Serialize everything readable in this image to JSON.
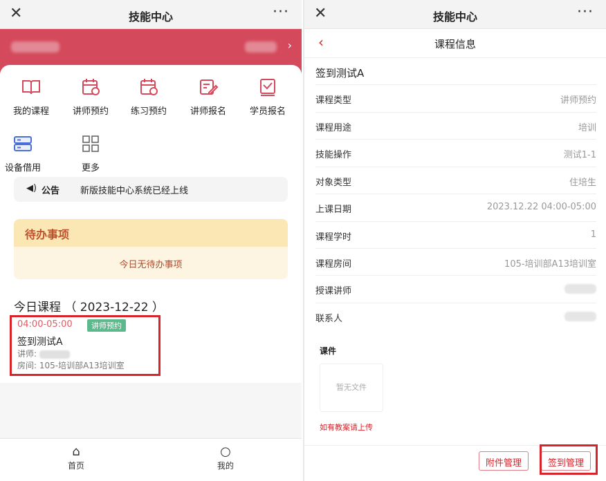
{
  "left": {
    "title": "技能中心",
    "grid": [
      {
        "label": "我的课程",
        "icon": "book-icon"
      },
      {
        "label": "讲师预约",
        "icon": "calendar-icon"
      },
      {
        "label": "练习预约",
        "icon": "calendar-icon"
      },
      {
        "label": "讲师报名",
        "icon": "edit-icon"
      },
      {
        "label": "学员报名",
        "icon": "check-icon"
      },
      {
        "label": "设备借用",
        "icon": "server-icon"
      },
      {
        "label": "更多",
        "icon": "grid-icon"
      }
    ],
    "notice": {
      "tag": "公告",
      "text": "新版技能中心系统已经上线"
    },
    "todo": {
      "title": "待办事项",
      "empty": "今日无待办事项"
    },
    "today": "今日课程 （ 2023-12-22 ）",
    "course": {
      "time": "04:00-05:00",
      "badge": "讲师预约",
      "name": "签到测试A",
      "teacher_label": "讲师:",
      "room": "房间: 105-培训部A13培训室"
    },
    "tabs": [
      {
        "label": "首页"
      },
      {
        "label": "我的"
      }
    ]
  },
  "right": {
    "title": "技能中心",
    "subtitle": "课程信息",
    "course_name": "签到测试A",
    "rows": [
      {
        "key": "课程类型",
        "value": "讲师预约"
      },
      {
        "key": "课程用途",
        "value": "培训"
      },
      {
        "key": "技能操作",
        "value": "测试1-1"
      },
      {
        "key": "对象类型",
        "value": "住培生"
      },
      {
        "key": "上课日期",
        "value": "2023.12.22 04:00-05:00"
      },
      {
        "key": "课程学时",
        "value": "1"
      },
      {
        "key": "课程房间",
        "value": "105-培训部A13培训室"
      },
      {
        "key": "授课讲师",
        "value": null
      },
      {
        "key": "联系人",
        "value": null
      }
    ],
    "file_label": "课件",
    "no_file": "暂无文件",
    "upload_hint": "如有教案请上传",
    "buttons": {
      "attach": "附件管理",
      "signin": "签到管理"
    }
  },
  "colors": {
    "brand": "#d44a5c",
    "accent": "#d8232a",
    "todo_head": "#fbe7b4",
    "badge": "#5bb98c"
  }
}
